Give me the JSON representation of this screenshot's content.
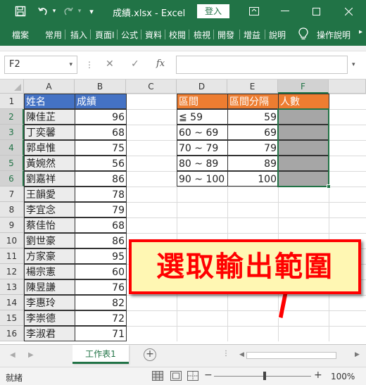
{
  "titlebar": {
    "save_icon": "save-icon",
    "title": "成績.xlsx - Excel",
    "login_label": "登入",
    "window_buttons": [
      "▭",
      "–",
      "□",
      "✕"
    ]
  },
  "ribbon": {
    "tabs": [
      "檔案",
      "常用",
      "插入",
      "頁面I",
      "公式",
      "資料",
      "校閱",
      "檢視",
      "開發",
      "增益",
      "說明",
      "操作說明"
    ]
  },
  "formula_bar": {
    "name_box": "F2",
    "cancel_symbol": "✕",
    "enter_symbol": "✓",
    "fx_symbol": "fx",
    "formula_value": ""
  },
  "grid": {
    "columns": [
      "A",
      "B",
      "C",
      "D",
      "E",
      "F"
    ],
    "rows": [
      "1",
      "2",
      "3",
      "4",
      "5",
      "6",
      "7",
      "8",
      "9",
      "10",
      "11",
      "12",
      "13",
      "14",
      "15",
      "16"
    ],
    "selected_column": "F",
    "selected_rows": [
      "2",
      "3",
      "4",
      "5",
      "6"
    ],
    "grade_table": {
      "header": [
        "姓名",
        "成績"
      ],
      "rows": [
        [
          "陳佳芷",
          "96"
        ],
        [
          "丁奕馨",
          "68"
        ],
        [
          "郭卓惟",
          "75"
        ],
        [
          "黃婉然",
          "56"
        ],
        [
          "劉嘉祥",
          "86"
        ],
        [
          "王韻愛",
          "78"
        ],
        [
          "李宜念",
          "79"
        ],
        [
          "蔡佳怡",
          "68"
        ],
        [
          "劉世豪",
          "86"
        ],
        [
          "方家豪",
          "95"
        ],
        [
          "楊宗憲",
          "60"
        ],
        [
          "陳昱謙",
          "76"
        ],
        [
          "李惠玲",
          "82"
        ],
        [
          "李崇德",
          "72"
        ],
        [
          "李淑君",
          "71"
        ]
      ]
    },
    "bin_table": {
      "header": [
        "區間",
        "區間分隔",
        "人數"
      ],
      "rows": [
        [
          "≦ 59",
          "59",
          ""
        ],
        [
          "60 ~ 69",
          "69",
          ""
        ],
        [
          "70 ~ 79",
          "79",
          ""
        ],
        [
          "80 ~ 89",
          "89",
          ""
        ],
        [
          "90 ~ 100",
          "100",
          ""
        ]
      ]
    },
    "header_blue": "#4472C4",
    "header_orange": "#ED7D31",
    "selection_fill": "#A6A6A6"
  },
  "callout": {
    "text": "選取輸出範圍",
    "border_color": "#FF0000",
    "background": "#FFF7B3"
  },
  "sheets": {
    "tabs": [
      "工作表1"
    ],
    "add_symbol": "+"
  },
  "status_bar": {
    "status": "就緒",
    "zoom": "100%",
    "zoom_minus": "−",
    "zoom_plus": "+"
  }
}
